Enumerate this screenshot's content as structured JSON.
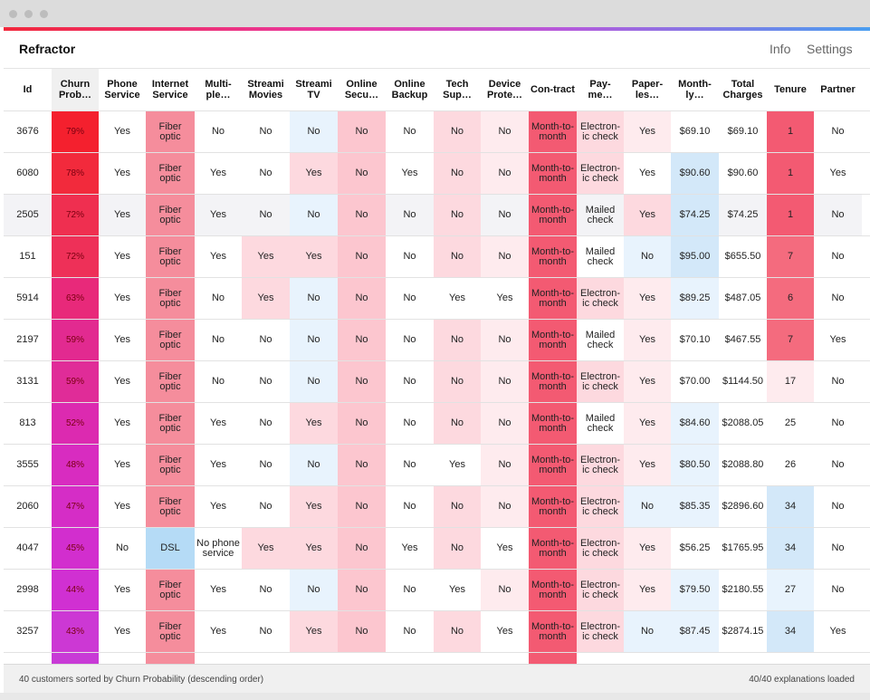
{
  "app": {
    "title": "Refractor",
    "nav": [
      "Info",
      "Settings"
    ]
  },
  "colors": {
    "accent_gradient": [
      "#f2283c",
      "#e83aa8",
      "#b45adc",
      "#4a9ef0"
    ]
  },
  "palette": {
    "W": "#ffffff",
    "F": "#f58d9c",
    "D": "#b5dbf6",
    "M": "#f35a72",
    "T": "#f46b7e",
    "P1": "#fcc6cf",
    "P2": "#fdd9df",
    "P3": "#feebee",
    "B1": "#d3e8f9",
    "B2": "#e8f3fd",
    "G": "#f3f3f6"
  },
  "columns": [
    "Id",
    "Churn Prob…",
    "Phone Service",
    "Internet Service",
    "Multi-ple…",
    "Streami Movies",
    "Streami TV",
    "Online Secu…",
    "Online Backup",
    "Tech Sup…",
    "Device Prote…",
    "Con-tract",
    "Pay-me…",
    "Paper-les…",
    "Month-ly…",
    "Total Charges",
    "Tenure",
    "Partner"
  ],
  "rows": [
    {
      "cells": [
        "3676",
        "79%",
        "Yes",
        "Fiber optic",
        "No",
        "No",
        "No",
        "No",
        "No",
        "No",
        "No",
        "Month-to-month",
        "Electron-ic check",
        "Yes",
        "$69.10",
        "$69.10",
        "1",
        "No"
      ],
      "churn_color": "#f4202e",
      "shades": [
        "W",
        "",
        "W",
        "F",
        "W",
        "W",
        "B2",
        "P1",
        "W",
        "P2",
        "P3",
        "M",
        "P2",
        "P3",
        "W",
        "W",
        "M",
        "W"
      ]
    },
    {
      "cells": [
        "6080",
        "78%",
        "Yes",
        "Fiber optic",
        "Yes",
        "No",
        "Yes",
        "No",
        "Yes",
        "No",
        "No",
        "Month-to-month",
        "Electron-ic check",
        "Yes",
        "$90.60",
        "$90.60",
        "1",
        "Yes"
      ],
      "churn_color": "#f22a3c",
      "shades": [
        "W",
        "",
        "W",
        "F",
        "W",
        "W",
        "P2",
        "P1",
        "W",
        "P2",
        "P3",
        "M",
        "P2",
        "W",
        "B1",
        "W",
        "M",
        "W"
      ]
    },
    {
      "cells": [
        "2505",
        "72%",
        "Yes",
        "Fiber optic",
        "Yes",
        "No",
        "No",
        "No",
        "No",
        "No",
        "No",
        "Month-to-month",
        "Mailed check",
        "Yes",
        "$74.25",
        "$74.25",
        "1",
        "No"
      ],
      "churn_color": "#ef2f50",
      "shades": [
        "G",
        "",
        "G",
        "F",
        "G",
        "G",
        "B2",
        "P1",
        "G",
        "P2",
        "G",
        "M",
        "G",
        "P2",
        "B1",
        "G",
        "M",
        "G"
      ]
    },
    {
      "cells": [
        "151",
        "72%",
        "Yes",
        "Fiber optic",
        "Yes",
        "Yes",
        "Yes",
        "No",
        "No",
        "No",
        "No",
        "Month-to-month",
        "Mailed check",
        "No",
        "$95.00",
        "$655.50",
        "7",
        "No"
      ],
      "churn_color": "#ee3058",
      "shades": [
        "W",
        "",
        "W",
        "F",
        "W",
        "P2",
        "P2",
        "P1",
        "W",
        "P2",
        "P3",
        "M",
        "W",
        "B2",
        "B1",
        "W",
        "T",
        "W"
      ]
    },
    {
      "cells": [
        "5914",
        "63%",
        "Yes",
        "Fiber optic",
        "No",
        "Yes",
        "No",
        "No",
        "No",
        "Yes",
        "Yes",
        "Month-to-month",
        "Electron-ic check",
        "Yes",
        "$89.25",
        "$487.05",
        "6",
        "No"
      ],
      "churn_color": "#e8297a",
      "shades": [
        "W",
        "",
        "W",
        "F",
        "W",
        "P2",
        "B2",
        "P1",
        "W",
        "W",
        "W",
        "M",
        "P2",
        "P3",
        "B2",
        "W",
        "T",
        "W"
      ]
    },
    {
      "cells": [
        "2197",
        "59%",
        "Yes",
        "Fiber optic",
        "No",
        "No",
        "No",
        "No",
        "No",
        "No",
        "No",
        "Month-to-month",
        "Mailed check",
        "Yes",
        "$70.10",
        "$467.55",
        "7",
        "Yes"
      ],
      "churn_color": "#e22a90",
      "shades": [
        "W",
        "",
        "W",
        "F",
        "W",
        "W",
        "B2",
        "P1",
        "W",
        "P2",
        "P3",
        "M",
        "W",
        "P3",
        "W",
        "W",
        "T",
        "W"
      ]
    },
    {
      "cells": [
        "3131",
        "59%",
        "Yes",
        "Fiber optic",
        "No",
        "No",
        "No",
        "No",
        "No",
        "No",
        "No",
        "Month-to-month",
        "Electron-ic check",
        "Yes",
        "$70.00",
        "$1144.50",
        "17",
        "No"
      ],
      "churn_color": "#e02c98",
      "shades": [
        "W",
        "",
        "W",
        "F",
        "W",
        "W",
        "B2",
        "P1",
        "W",
        "P2",
        "P3",
        "M",
        "P2",
        "P3",
        "W",
        "W",
        "P3",
        "W"
      ]
    },
    {
      "cells": [
        "813",
        "52%",
        "Yes",
        "Fiber optic",
        "Yes",
        "No",
        "Yes",
        "No",
        "No",
        "No",
        "No",
        "Month-to-month",
        "Mailed check",
        "Yes",
        "$84.60",
        "$2088.05",
        "25",
        "No"
      ],
      "churn_color": "#dc2ab0",
      "shades": [
        "W",
        "",
        "W",
        "F",
        "W",
        "W",
        "P2",
        "P1",
        "W",
        "P2",
        "P3",
        "M",
        "W",
        "P3",
        "B2",
        "W",
        "W",
        "W"
      ]
    },
    {
      "cells": [
        "3555",
        "48%",
        "Yes",
        "Fiber optic",
        "Yes",
        "No",
        "No",
        "No",
        "No",
        "Yes",
        "No",
        "Month-to-month",
        "Electron-ic check",
        "Yes",
        "$80.50",
        "$2088.80",
        "26",
        "No"
      ],
      "churn_color": "#d82cc0",
      "shades": [
        "W",
        "",
        "W",
        "F",
        "W",
        "W",
        "B2",
        "P1",
        "W",
        "W",
        "P3",
        "M",
        "P2",
        "P3",
        "B2",
        "W",
        "W",
        "W"
      ]
    },
    {
      "cells": [
        "2060",
        "47%",
        "Yes",
        "Fiber optic",
        "Yes",
        "No",
        "Yes",
        "No",
        "No",
        "No",
        "No",
        "Month-to-month",
        "Electron-ic check",
        "No",
        "$85.35",
        "$2896.60",
        "34",
        "No"
      ],
      "churn_color": "#d52dc6",
      "shades": [
        "W",
        "",
        "W",
        "F",
        "W",
        "W",
        "P2",
        "P1",
        "W",
        "P2",
        "P3",
        "M",
        "P2",
        "B2",
        "B2",
        "W",
        "B1",
        "W"
      ]
    },
    {
      "cells": [
        "4047",
        "45%",
        "No",
        "DSL",
        "No phone service",
        "Yes",
        "Yes",
        "No",
        "Yes",
        "No",
        "Yes",
        "Month-to-month",
        "Electron-ic check",
        "Yes",
        "$56.25",
        "$1765.95",
        "34",
        "No"
      ],
      "churn_color": "#d22ece",
      "shades": [
        "W",
        "",
        "W",
        "D",
        "W",
        "P2",
        "P2",
        "P1",
        "W",
        "P2",
        "W",
        "M",
        "P2",
        "P3",
        "W",
        "W",
        "B1",
        "W"
      ]
    },
    {
      "cells": [
        "2998",
        "44%",
        "Yes",
        "Fiber optic",
        "Yes",
        "No",
        "No",
        "No",
        "No",
        "Yes",
        "No",
        "Month-to-month",
        "Electron-ic check",
        "Yes",
        "$79.50",
        "$2180.55",
        "27",
        "No"
      ],
      "churn_color": "#d030d2",
      "shades": [
        "W",
        "",
        "W",
        "F",
        "W",
        "W",
        "B2",
        "P1",
        "W",
        "W",
        "P3",
        "M",
        "P2",
        "P3",
        "B2",
        "W",
        "B2",
        "W"
      ]
    },
    {
      "cells": [
        "3257",
        "43%",
        "Yes",
        "Fiber optic",
        "Yes",
        "No",
        "Yes",
        "No",
        "No",
        "No",
        "Yes",
        "Month-to-month",
        "Electron-ic check",
        "No",
        "$87.45",
        "$2874.15",
        "34",
        "Yes"
      ],
      "churn_color": "#cc38d4",
      "shades": [
        "W",
        "",
        "W",
        "F",
        "W",
        "W",
        "P2",
        "P1",
        "W",
        "P2",
        "W",
        "M",
        "P2",
        "B2",
        "B2",
        "W",
        "B1",
        "W"
      ]
    }
  ],
  "footer": {
    "left": "40 customers sorted by Churn Probability (descending order)",
    "right": "40/40 explanations loaded"
  }
}
